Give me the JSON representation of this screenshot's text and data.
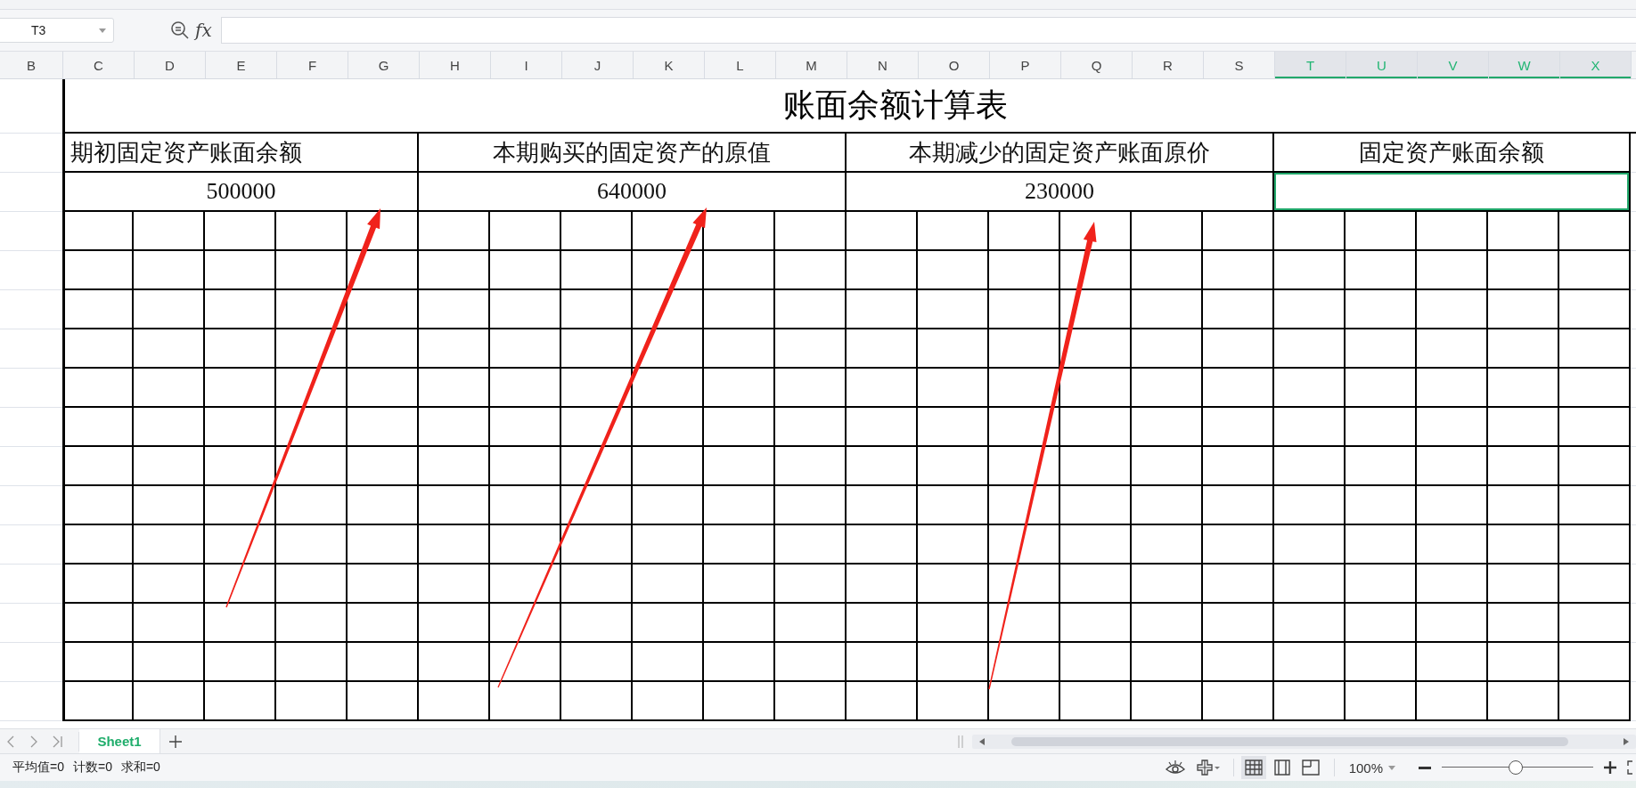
{
  "formula_bar": {
    "name_box": "T3",
    "fx_label": "fx"
  },
  "column_headers": [
    {
      "label": "B",
      "selected": false
    },
    {
      "label": "C",
      "selected": false
    },
    {
      "label": "D",
      "selected": false
    },
    {
      "label": "E",
      "selected": false
    },
    {
      "label": "F",
      "selected": false
    },
    {
      "label": "G",
      "selected": false
    },
    {
      "label": "H",
      "selected": false
    },
    {
      "label": "I",
      "selected": false
    },
    {
      "label": "J",
      "selected": false
    },
    {
      "label": "K",
      "selected": false
    },
    {
      "label": "L",
      "selected": false
    },
    {
      "label": "M",
      "selected": false
    },
    {
      "label": "N",
      "selected": false
    },
    {
      "label": "O",
      "selected": false
    },
    {
      "label": "P",
      "selected": false
    },
    {
      "label": "Q",
      "selected": false
    },
    {
      "label": "R",
      "selected": false
    },
    {
      "label": "S",
      "selected": false
    },
    {
      "label": "T",
      "selected": true
    },
    {
      "label": "U",
      "selected": true
    },
    {
      "label": "V",
      "selected": true
    },
    {
      "label": "W",
      "selected": true
    },
    {
      "label": "X",
      "selected": true
    }
  ],
  "sheet": {
    "title": "账面余额计算表",
    "groups": [
      {
        "header": "期初固定资产账面余额",
        "value": "500000",
        "selected": false
      },
      {
        "header": "本期购买的固定资产的原值",
        "value": "640000",
        "selected": false
      },
      {
        "header": "本期减少的固定资产账面原价",
        "value": "230000",
        "selected": false
      },
      {
        "header": "固定资产账面余额",
        "selected": true
      }
    ]
  },
  "sheet_tabs": [
    {
      "label": "Sheet1",
      "selected": true
    }
  ],
  "status_bar": {
    "stats": [
      "平均值=0",
      "计数=0",
      "求和=0"
    ],
    "view_modes": [
      {
        "kind": "normal",
        "selected": true
      },
      {
        "kind": "split",
        "selected": false
      },
      {
        "kind": "layout",
        "selected": false
      }
    ],
    "zoom": {
      "label": "100%",
      "level": 0.49
    }
  }
}
